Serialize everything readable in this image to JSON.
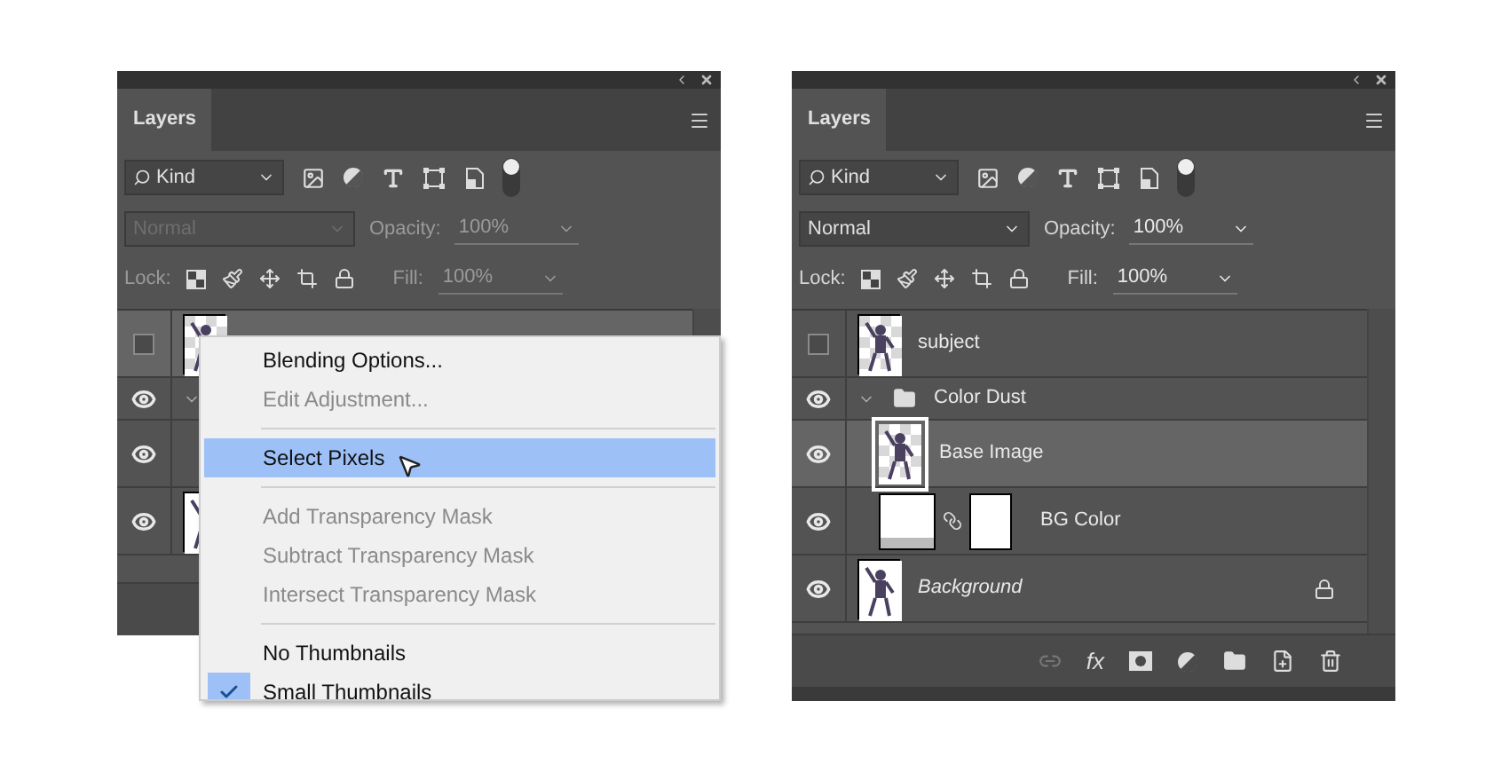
{
  "panels": [
    {
      "tab": "Layers",
      "filter": "Kind",
      "blend_mode": "Normal",
      "opacity_label": "Opacity:",
      "opacity": "100%",
      "lock_label": "Lock:",
      "fill_label": "Fill:",
      "fill": "100%",
      "disabled": true,
      "footer_icons": false,
      "layers": [
        {
          "kind": "layer",
          "visible": false,
          "selected": true,
          "thumbnail": true,
          "transparent": true
        },
        {
          "kind": "group",
          "visible": true,
          "selected": false,
          "expanded": true,
          "covered": true
        },
        {
          "kind": "layer",
          "visible": true,
          "selected": false
        },
        {
          "kind": "layer",
          "visible": true,
          "selected": false,
          "thumbnail": true,
          "transparent": false
        }
      ]
    },
    {
      "tab": "Layers",
      "filter": "Kind",
      "blend_mode": "Normal",
      "opacity_label": "Opacity:",
      "opacity": "100%",
      "lock_label": "Lock:",
      "fill_label": "Fill:",
      "fill": "100%",
      "disabled": false,
      "footer_icons": true,
      "fx": "fx",
      "layers": [
        {
          "kind": "layer",
          "name": "subject",
          "visible": false,
          "selected": false,
          "thumbnail": true,
          "transparent": true
        },
        {
          "kind": "group",
          "name": "Color Dust",
          "visible": true,
          "selected": false,
          "expanded": true,
          "children": [
            {
              "kind": "layer",
              "name": "Base Image",
              "visible": true,
              "selected": true,
              "thumbnail": true,
              "transparent": true
            },
            {
              "kind": "fill",
              "name": "BG Color",
              "visible": true,
              "selected": false
            }
          ]
        },
        {
          "kind": "layer",
          "name": "Background",
          "visible": true,
          "selected": false,
          "thumbnail": true,
          "transparent": false,
          "italic": true,
          "locked": true
        }
      ]
    }
  ],
  "context_menu": {
    "items": [
      {
        "kind": "item",
        "label": "Blending Options...",
        "disabled": false,
        "selected": false,
        "checked": false
      },
      {
        "kind": "item",
        "label": "Edit Adjustment...",
        "disabled": true,
        "selected": false,
        "checked": false
      },
      {
        "kind": "separator"
      },
      {
        "kind": "item",
        "label": "Select Pixels",
        "disabled": false,
        "selected": true,
        "checked": false
      },
      {
        "kind": "separator"
      },
      {
        "kind": "item",
        "label": "Add Transparency Mask",
        "disabled": true,
        "selected": false,
        "checked": false
      },
      {
        "kind": "item",
        "label": "Subtract Transparency Mask",
        "disabled": true,
        "selected": false,
        "checked": false
      },
      {
        "kind": "item",
        "label": "Intersect Transparency Mask",
        "disabled": true,
        "selected": false,
        "checked": false
      },
      {
        "kind": "separator"
      },
      {
        "kind": "item",
        "label": "No Thumbnails",
        "disabled": false,
        "selected": false,
        "checked": false
      },
      {
        "kind": "item",
        "label": "Small Thumbnails",
        "disabled": false,
        "selected": false,
        "checked": true
      }
    ]
  }
}
